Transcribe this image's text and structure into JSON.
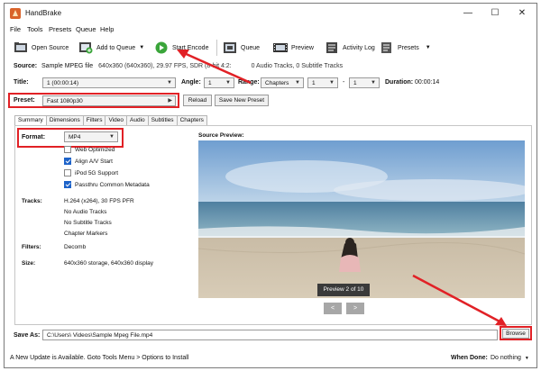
{
  "window": {
    "title": "HandBrake",
    "controls": [
      "—",
      "☐",
      "✕"
    ]
  },
  "menu": [
    "File",
    "Tools",
    "Presets",
    "Queue",
    "Help"
  ],
  "toolbar": {
    "open_source": "Open Source",
    "add_to_queue": "Add to Queue",
    "start_encode": "Start Encode",
    "queue": "Queue",
    "preview": "Preview",
    "activity_log": "Activity Log",
    "presets": "Presets"
  },
  "source": {
    "label": "Source:",
    "name": "Sample MPEG file",
    "details": "640x360 (640x360), 29.97 FPS, SDR (8-bit 4:2:",
    "details_tail": "0 Audio Tracks, 0 Subtitle Tracks"
  },
  "title_row": {
    "title_label": "Title:",
    "title_value": "1 (00:00:14)",
    "angle_label": "Angle:",
    "angle_value": "1",
    "range_label": "Range:",
    "range_value": "Chapters",
    "range_from": "1",
    "range_dash": "-",
    "range_to": "1",
    "duration_label": "Duration:",
    "duration_value": "00:00:14"
  },
  "preset": {
    "label": "Preset:",
    "value": "Fast 1080p30",
    "reload": "Reload",
    "save_new": "Save New Preset"
  },
  "tabs": [
    "Summary",
    "Dimensions",
    "Filters",
    "Video",
    "Audio",
    "Subtitles",
    "Chapters"
  ],
  "summary": {
    "format_label": "Format:",
    "format_value": "MP4",
    "options": [
      {
        "label": "Web Optimized",
        "checked": false
      },
      {
        "label": "Align A/V Start",
        "checked": true
      },
      {
        "label": "iPod 5G Support",
        "checked": false
      },
      {
        "label": "Passthru Common Metadata",
        "checked": true
      }
    ],
    "tracks_label": "Tracks:",
    "tracks": [
      "H.264 (x264), 30 FPS PFR",
      "No Audio Tracks",
      "No Subtitle Tracks",
      "Chapter Markers"
    ],
    "filters_label": "Filters:",
    "filters_value": "Decomb",
    "size_label": "Size:",
    "size_value": "640x360 storage, 640x360 display",
    "preview_label": "Source Preview:",
    "preview_badge": "Preview 2 of 10",
    "prev": "<",
    "next": ">"
  },
  "save_as": {
    "label": "Save As:",
    "path": "C:\\Users\\        Videos\\Sample Mpeg File.mp4",
    "browse": "Browse"
  },
  "status": {
    "message": "A New Update is Available. Goto Tools Menu > Options to Install",
    "when_done_label": "When Done:",
    "when_done_value": "Do nothing"
  },
  "colors": {
    "annotation_red": "#e12126",
    "play_green": "#3aa53a"
  }
}
